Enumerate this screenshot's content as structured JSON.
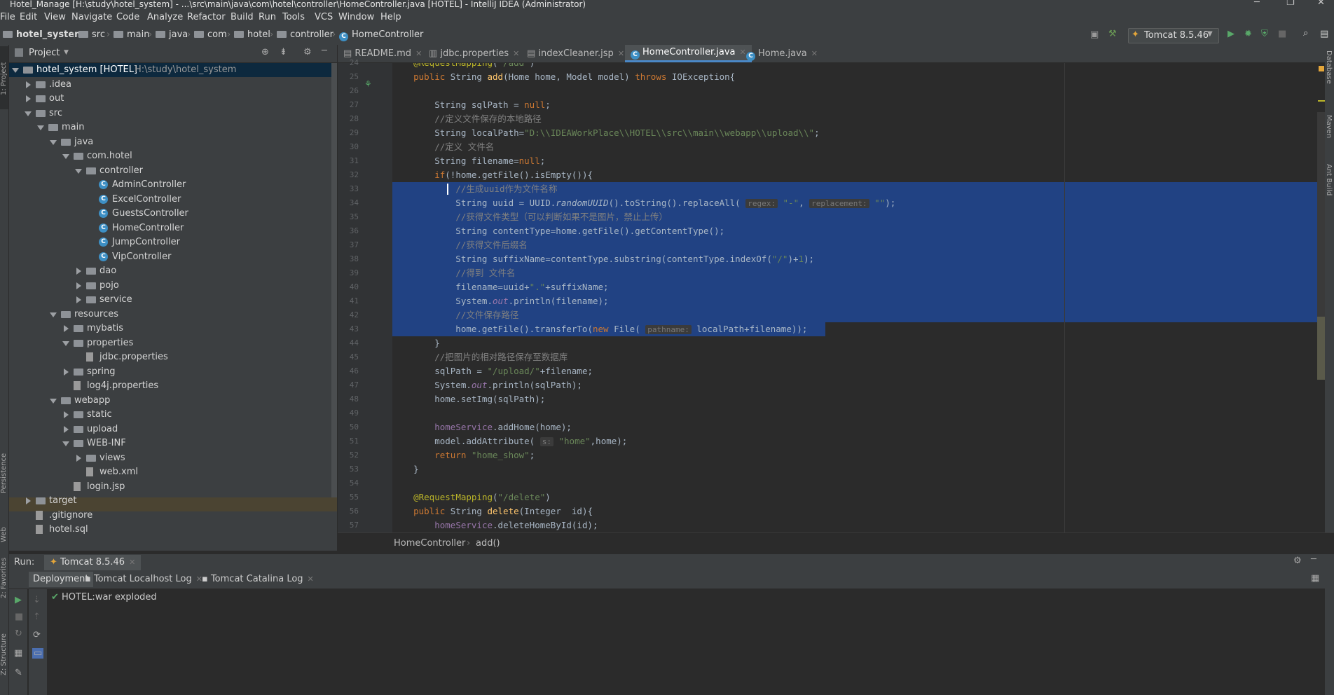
{
  "window": {
    "title": "Hotel_Manage [H:\\study\\hotel_system] - ...\\src\\main\\java\\com\\hotel\\controller\\HomeController.java [HOTEL] - IntelliJ IDEA (Administrator)"
  },
  "menu": [
    "File",
    "Edit",
    "View",
    "Navigate",
    "Code",
    "Analyze",
    "Refactor",
    "Build",
    "Run",
    "Tools",
    "VCS",
    "Window",
    "Help"
  ],
  "breadcrumb": [
    "hotel_system",
    "src",
    "main",
    "java",
    "com",
    "hotel",
    "controller",
    "HomeController"
  ],
  "run_config": "Tomcat 8.5.46",
  "left_stripe": {
    "project": "1: Project",
    "persistence": "Persistence",
    "web": "Web",
    "favorites": "2: Favorites",
    "structure": "Z: Structure"
  },
  "right_stripe": {
    "database": "Database",
    "maven": "Maven",
    "ant": "Ant Build"
  },
  "project_panel": {
    "title": "Project",
    "tree": [
      {
        "label": "hotel_system [HOTEL]",
        "hint": "H:\\study\\hotel_system",
        "type": "module",
        "state": "open",
        "indent": 0
      },
      {
        "label": ".idea",
        "type": "folder",
        "state": "closed",
        "indent": 1
      },
      {
        "label": "out",
        "type": "folder",
        "state": "closed",
        "indent": 1
      },
      {
        "label": "src",
        "type": "folder",
        "state": "open",
        "indent": 1
      },
      {
        "label": "main",
        "type": "folder",
        "state": "open",
        "indent": 2
      },
      {
        "label": "java",
        "type": "folder",
        "state": "open",
        "indent": 3
      },
      {
        "label": "com.hotel",
        "type": "package",
        "state": "open",
        "indent": 4
      },
      {
        "label": "controller",
        "type": "package",
        "state": "open",
        "indent": 5
      },
      {
        "label": "AdminController",
        "type": "class",
        "indent": 6
      },
      {
        "label": "ExcelController",
        "type": "class",
        "indent": 6
      },
      {
        "label": "GuestsController",
        "type": "class",
        "indent": 6
      },
      {
        "label": "HomeController",
        "type": "class",
        "indent": 6
      },
      {
        "label": "JumpController",
        "type": "class",
        "indent": 6
      },
      {
        "label": "VipController",
        "type": "class",
        "indent": 6
      },
      {
        "label": "dao",
        "type": "package",
        "state": "closed",
        "indent": 5
      },
      {
        "label": "pojo",
        "type": "package",
        "state": "closed",
        "indent": 5
      },
      {
        "label": "service",
        "type": "package",
        "state": "closed",
        "indent": 5
      },
      {
        "label": "resources",
        "type": "folder",
        "state": "open",
        "indent": 3
      },
      {
        "label": "mybatis",
        "type": "folder",
        "state": "closed",
        "indent": 4
      },
      {
        "label": "properties",
        "type": "folder",
        "state": "open",
        "indent": 4
      },
      {
        "label": "jdbc.properties",
        "type": "file",
        "indent": 5
      },
      {
        "label": "spring",
        "type": "folder",
        "state": "closed",
        "indent": 4
      },
      {
        "label": "log4j.properties",
        "type": "file",
        "indent": 4
      },
      {
        "label": "webapp",
        "type": "folder",
        "state": "open",
        "indent": 3
      },
      {
        "label": "static",
        "type": "folder",
        "state": "closed",
        "indent": 4
      },
      {
        "label": "upload",
        "type": "folder",
        "state": "closed",
        "indent": 4
      },
      {
        "label": "WEB-INF",
        "type": "folder",
        "state": "open",
        "indent": 4
      },
      {
        "label": "views",
        "type": "folder",
        "state": "closed",
        "indent": 5
      },
      {
        "label": "web.xml",
        "type": "file",
        "indent": 5
      },
      {
        "label": "login.jsp",
        "type": "file",
        "indent": 4
      },
      {
        "label": "target",
        "type": "folder",
        "state": "closed",
        "indent": 1,
        "highlight": true
      },
      {
        "label": ".gitignore",
        "type": "file",
        "indent": 1
      },
      {
        "label": "hotel.sql",
        "type": "file",
        "indent": 1
      }
    ]
  },
  "editor_tabs": [
    {
      "label": "README.md",
      "active": false
    },
    {
      "label": "jdbc.properties",
      "active": false
    },
    {
      "label": "indexCleaner.jsp",
      "active": false
    },
    {
      "label": "HomeController.java",
      "active": true
    },
    {
      "label": "Home.java",
      "active": false
    }
  ],
  "code_lines": [
    {
      "n": "24",
      "html": "    <span class=\"an\">@RequestMapping</span>(<span class=\"str\">\"/add\"</span>)"
    },
    {
      "n": "25",
      "html": "    <span class=\"kw\">public</span> String <span class=\"fn\">add</span>(Home home, Model model) <span class=\"kw\">throws</span> IOException{"
    },
    {
      "n": "26",
      "html": ""
    },
    {
      "n": "27",
      "html": "        String sqlPath = <span class=\"kw\">null</span>;"
    },
    {
      "n": "28",
      "html": "        <span class=\"cmt\">//定义文件保存的本地路径</span>"
    },
    {
      "n": "29",
      "html": "        String localPath=<span class=\"str\">\"D:\\\\IDEAWorkPlace\\\\HOTEL\\\\src\\\\main\\\\webapp\\\\upload\\\\\"</span>;"
    },
    {
      "n": "30",
      "html": "        <span class=\"cmt\">//定义 文件名</span>"
    },
    {
      "n": "31",
      "html": "        String filename=<span class=\"kw\">null</span>;"
    },
    {
      "n": "32",
      "html": "        <span class=\"kw\">if</span>(!home.getFile().isEmpty()){"
    },
    {
      "n": "33",
      "html": "            <span class=\"cmt\">//生成uuid作为文件名称</span>",
      "sel": true
    },
    {
      "n": "34",
      "html": "            String uuid = UUID.<span class=\"it\">randomUUID</span>().toString().replaceAll( <span class=\"hint\">regex:</span> <span class=\"str\">\"-\"</span>, <span class=\"hint\">replacement:</span> <span class=\"str\">\"\"</span>);",
      "sel": true
    },
    {
      "n": "35",
      "html": "            <span class=\"cmt\">//获得文件类型（可以判断如果不是图片，禁止上传）</span>",
      "sel": true
    },
    {
      "n": "36",
      "html": "            String contentType=home.getFile().getContentType();",
      "sel": true
    },
    {
      "n": "37",
      "html": "            <span class=\"cmt\">//获得文件后缀名</span>",
      "sel": true
    },
    {
      "n": "38",
      "html": "            String suffixName=contentType.substring(contentType.indexOf(<span class=\"str\">\"/\"</span>)+<span class=\"str\">1</span>);",
      "sel": true
    },
    {
      "n": "39",
      "html": "            <span class=\"cmt\">//得到 文件名</span>",
      "sel": true
    },
    {
      "n": "40",
      "html": "            filename=uuid+<span class=\"str\">\".\"</span>+suffixName;",
      "sel": true
    },
    {
      "n": "41",
      "html": "            System.<span class=\"fld it\">out</span>.println(filename);",
      "sel": true
    },
    {
      "n": "42",
      "html": "            <span class=\"cmt\">//文件保存路径</span>",
      "sel": true
    },
    {
      "n": "43",
      "html": "            home.getFile().transferTo(<span class=\"kw\">new</span> File( <span class=\"hint\">pathname:</span> localPath+filename));",
      "sel": "partial"
    },
    {
      "n": "44",
      "html": "        }"
    },
    {
      "n": "45",
      "html": "        <span class=\"cmt\">//把图片的相对路径保存至数据库</span>"
    },
    {
      "n": "46",
      "html": "        sqlPath = <span class=\"str\">\"/upload/\"</span>+filename;"
    },
    {
      "n": "47",
      "html": "        System.<span class=\"fld it\">out</span>.println(sqlPath);"
    },
    {
      "n": "48",
      "html": "        home.setImg(sqlPath);"
    },
    {
      "n": "49",
      "html": ""
    },
    {
      "n": "50",
      "html": "        <span class=\"fld\">homeService</span>.addHome(home);"
    },
    {
      "n": "51",
      "html": "        model.addAttribute( <span class=\"hint\">s:</span> <span class=\"str\">\"home\"</span>,home);"
    },
    {
      "n": "52",
      "html": "        <span class=\"kw\">return</span> <span class=\"str\">\"home_show\"</span>;"
    },
    {
      "n": "53",
      "html": "    }"
    },
    {
      "n": "54",
      "html": ""
    },
    {
      "n": "55",
      "html": "    <span class=\"an\">@RequestMapping</span>(<span class=\"str\">\"/delete\"</span>)"
    },
    {
      "n": "56",
      "html": "    <span class=\"kw\">public</span> String <span class=\"fn\">delete</span>(Integer  id){"
    },
    {
      "n": "57",
      "html": "        <span class=\"fld\">homeService</span>.deleteHomeById(id);"
    }
  ],
  "editor_breadcrumb": [
    "HomeController",
    "add()"
  ],
  "run_panel": {
    "label": "Run:",
    "config": "Tomcat 8.5.46",
    "tabs": [
      "Deployment",
      "Tomcat Localhost Log",
      "Tomcat Catalina Log"
    ],
    "deployment_item": "HOTEL:war exploded"
  },
  "colors": {
    "selection": "#214283",
    "keyword": "#cc7832",
    "string": "#6a8759",
    "comment": "#808080",
    "annotation": "#bbb529",
    "panel": "#3c3f41",
    "editor": "#2b2b2b"
  }
}
